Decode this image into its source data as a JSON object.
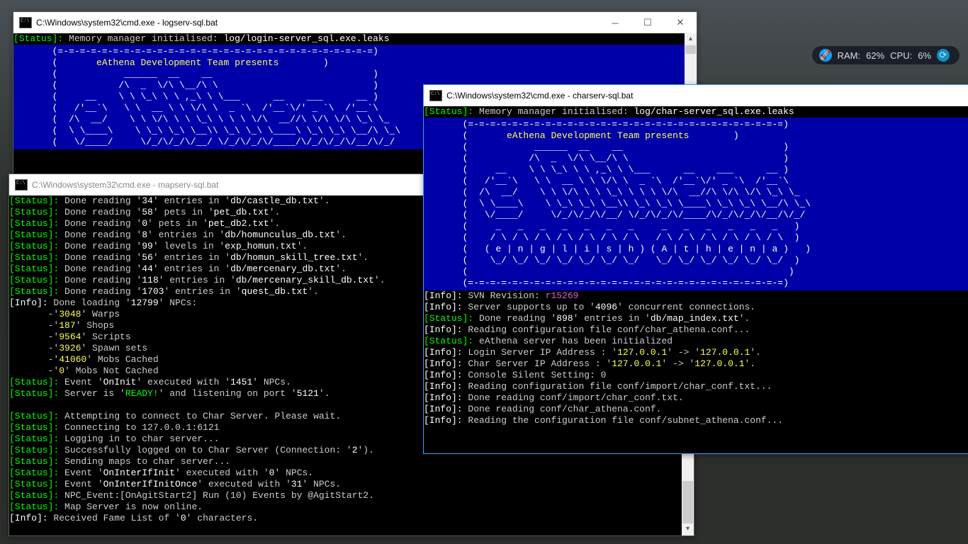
{
  "hud": {
    "ram_label": "RAM:",
    "ram_value": "62",
    "cpu_label": "CPU:",
    "cpu_value": "6",
    "pct": "%"
  },
  "win1": {
    "title": "C:\\Windows\\system32\\cmd.exe - logserv-sql.bat",
    "status_line_pre": "[Status]:",
    "status_line_txt": " Memory manager initialised: ",
    "status_line_file": "log/login-server_sql.exe.leaks",
    "banner_header": "eAthena Development Team presents"
  },
  "win2": {
    "title": "C:\\Windows\\system32\\cmd.exe - charserv-sql.bat",
    "status_line_pre": "[Status]:",
    "status_line_txt": " Memory manager initialised: ",
    "status_line_file": "log/char-server_sql.exe.leaks",
    "banner_header": "eAthena Development Team presents",
    "footer_word": "( e | n | g | l | i | s | h ) ( A | t | h | e | n | a )",
    "lines": {
      "l1a": "[Info]: ",
      "l1b": "SVN Revision: ",
      "l1c": "r15269",
      "l2a": "[Info]: ",
      "l2b": "Server supports up to '",
      "l2c": "4096",
      "l2d": "' concurrent connections.",
      "l3a": "[Status]: ",
      "l3b": "Done reading '",
      "l3c": "898",
      "l3d": "' entries in '",
      "l3e": "db/map_index.txt",
      "l3f": "'.",
      "l4a": "[Info]: ",
      "l4b": "Reading configuration file conf/char_athena.conf...",
      "l5a": "[Status]: ",
      "l5b": "eAthena server has been initialized",
      "l6a": "[Info]: ",
      "l6b": "Login Server IP Address : '",
      "l6c": "127.0.0.1",
      "l6d": "' -> '",
      "l6e": "127.0.0.1",
      "l6f": "'.",
      "l7a": "[Info]: ",
      "l7b": "Char Server IP Address : '",
      "l7c": "127.0.0.1",
      "l7d": "' -> '",
      "l7e": "127.0.0.1",
      "l7f": "'.",
      "l8a": "[Info]: ",
      "l8b": "Console Silent Setting: 0",
      "l9a": "[Info]: ",
      "l9b": "Reading configuration file conf/import/char_conf.txt...",
      "l10a": "[Info]: ",
      "l10b": "Done reading conf/import/char_conf.txt.",
      "l11a": "[Info]: ",
      "l11b": "Done reading conf/char_athena.conf.",
      "l12a": "[Info]: ",
      "l12b": "Reading the configuration file conf/subnet_athena.conf..."
    }
  },
  "win3": {
    "title": "C:\\Windows\\system32\\cmd.exe - mapserv-sql.bat",
    "lines": {
      "s1": {
        "t": "[Status]: ",
        "a": "Done reading '",
        "n": "34",
        "b": "' entries in '",
        "f": "db/castle_db.txt",
        "c": "'."
      },
      "s2": {
        "t": "[Status]: ",
        "a": "Done reading '",
        "n": "58",
        "b": "' pets in '",
        "f": "pet_db.txt",
        "c": "'."
      },
      "s3": {
        "t": "[Status]: ",
        "a": "Done reading '",
        "n": "0",
        "b": "' pets in '",
        "f": "pet_db2.txt",
        "c": "'."
      },
      "s4": {
        "t": "[Status]: ",
        "a": "Done reading '",
        "n": "8",
        "b": "' entries in '",
        "f": "db/homunculus_db.txt",
        "c": "'."
      },
      "s5": {
        "t": "[Status]: ",
        "a": "Done reading '",
        "n": "99",
        "b": "' levels in '",
        "f": "exp_homun.txt",
        "c": "'."
      },
      "s6": {
        "t": "[Status]: ",
        "a": "Done reading '",
        "n": "56",
        "b": "' entries in '",
        "f": "db/homun_skill_tree.txt",
        "c": "'."
      },
      "s7": {
        "t": "[Status]: ",
        "a": "Done reading '",
        "n": "44",
        "b": "' entries in '",
        "f": "db/mercenary_db.txt",
        "c": "'."
      },
      "s8": {
        "t": "[Status]: ",
        "a": "Done reading '",
        "n": "118",
        "b": "' entries in '",
        "f": "db/mercenary_skill_db.txt",
        "c": "'."
      },
      "s9": {
        "t": "[Status]: ",
        "a": "Done reading '",
        "n": "1703",
        "b": "' entries in '",
        "f": "quest_db.txt",
        "c": "'."
      },
      "i1": {
        "t": "[Info]: ",
        "a": "Done loading '",
        "n": "12799",
        "b": "' NPCs:"
      },
      "npc1": {
        "p": "       -'",
        "n": "3048",
        "s": "' Warps"
      },
      "npc2": {
        "p": "       -'",
        "n": "187",
        "s": "' Shops"
      },
      "npc3": {
        "p": "       -'",
        "n": "9564",
        "s": "' Scripts"
      },
      "npc4": {
        "p": "       -'",
        "n": "3926",
        "s": "' Spawn sets"
      },
      "npc5": {
        "p": "       -'",
        "n": "41060",
        "s": "' Mobs Cached"
      },
      "npc6": {
        "p": "       -'",
        "n": "0",
        "s": "' Mobs Not Cached"
      },
      "e1": {
        "t": "[Status]: ",
        "a": "Event '",
        "f": "OnInit",
        "b": "' executed with '",
        "n": "1451",
        "c": "' NPCs."
      },
      "e2": {
        "t": "[Status]: ",
        "a": "Server is '",
        "f": "READY!",
        "b": "' and listening on port '",
        "n": "5121",
        "c": "'."
      },
      "blank": " ",
      "c1": {
        "t": "[Status]: ",
        "a": "Attempting to connect to Char Server. Please wait."
      },
      "c2": {
        "t": "[Status]: ",
        "a": "Connecting to 127.0.0.1:6121"
      },
      "c3": {
        "t": "[Status]: ",
        "a": "Logging in to char server..."
      },
      "c4": {
        "t": "[Status]: ",
        "a": "Successfully logged on to Char Server (Connection: '",
        "n": "2",
        "b": "')."
      },
      "c5": {
        "t": "[Status]: ",
        "a": "Sending maps to char server..."
      },
      "c6": {
        "t": "[Status]: ",
        "a": "Event '",
        "f": "OnInterIfInit",
        "b": "' executed with '",
        "n": "0",
        "c": "' NPCs."
      },
      "c7": {
        "t": "[Status]: ",
        "a": "Event '",
        "f": "OnInterIfInitOnce",
        "b": "' executed with '",
        "n": "31",
        "c": "' NPCs."
      },
      "c8": {
        "t": "[Status]: ",
        "a": "NPC_Event:[OnAgitStart2] Run (10) Events by @AgitStart2."
      },
      "c9": {
        "t": "[Status]: ",
        "a": "Map Server is now online."
      },
      "i2": {
        "t": "[Info]: ",
        "a": "Received Fame List of '",
        "n": "0",
        "b": "' characters."
      }
    }
  }
}
